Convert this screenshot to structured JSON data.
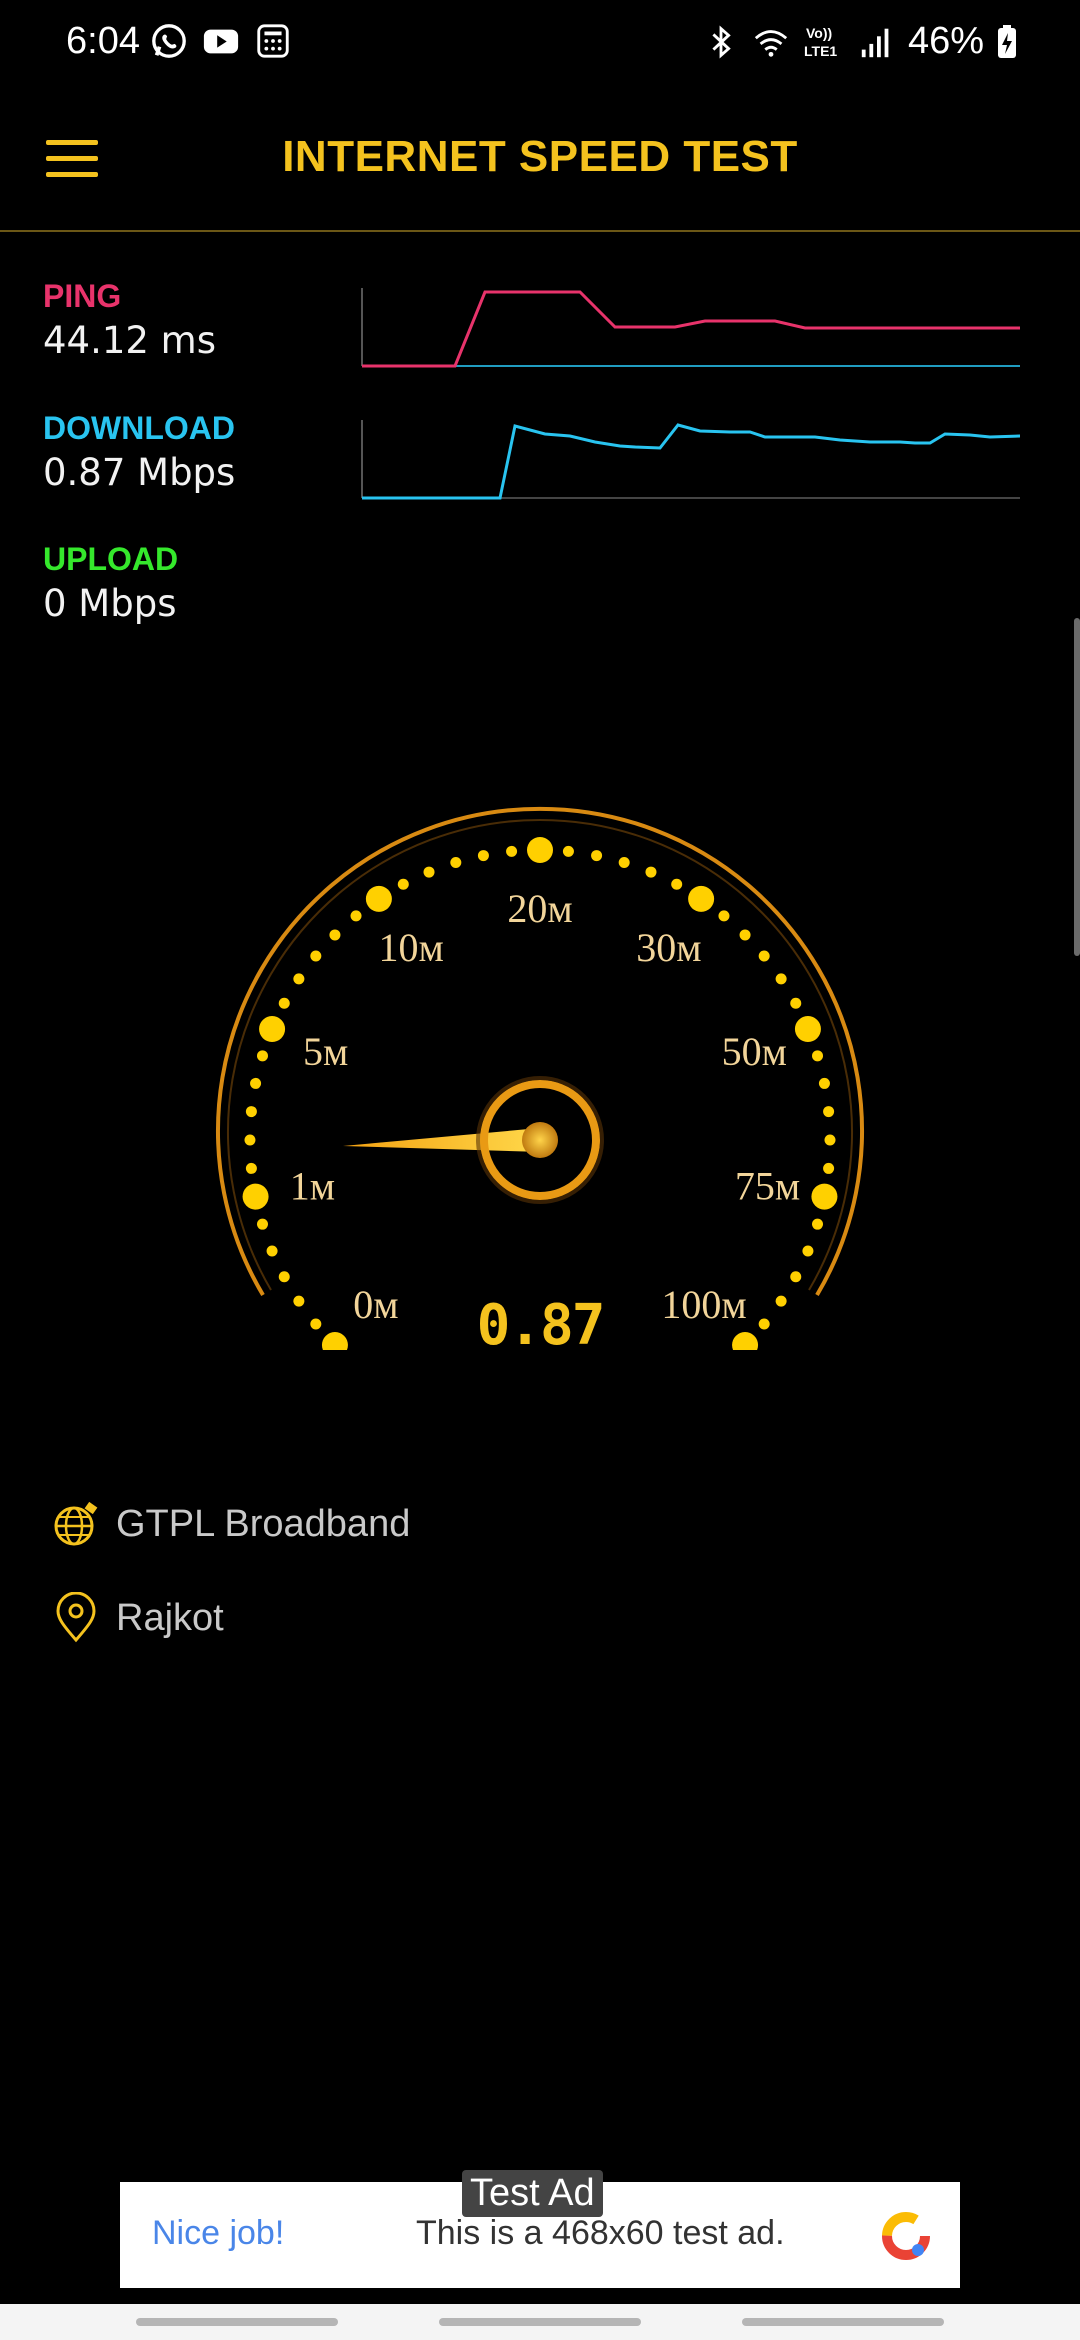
{
  "status_bar": {
    "time": "6:04",
    "battery": "46%",
    "left_icons": [
      "whatsapp-icon",
      "youtube-icon",
      "calculator-icon"
    ],
    "right_icons": [
      "bluetooth-icon",
      "wifi-icon",
      "volte-lte1-icon",
      "signal-icon",
      "battery-charging-icon"
    ],
    "volte_text": "Vo)) LTE1"
  },
  "header": {
    "title": "INTERNET SPEED TEST",
    "accent_color": "#f4c21e"
  },
  "metrics": {
    "ping": {
      "label": "PING",
      "value": "44.12 ms",
      "color": "#e8336b"
    },
    "download": {
      "label": "DOWNLOAD",
      "value": "0.87 Mbps",
      "color": "#29c4f0"
    },
    "upload": {
      "label": "UPLOAD",
      "value": "0 Mbps",
      "color": "#35e82c"
    }
  },
  "gauge": {
    "ticks": [
      "0м",
      "1м",
      "5м",
      "10м",
      "20м",
      "30м",
      "50м",
      "75м",
      "100м"
    ],
    "needle_value": 0.87,
    "readout": "0.87"
  },
  "info": {
    "isp": "GTPL Broadband",
    "location": "Rajkot"
  },
  "ad": {
    "tag": "Test Ad",
    "left_text": "Nice job!",
    "body_text": "This is a 468x60 test ad."
  }
}
